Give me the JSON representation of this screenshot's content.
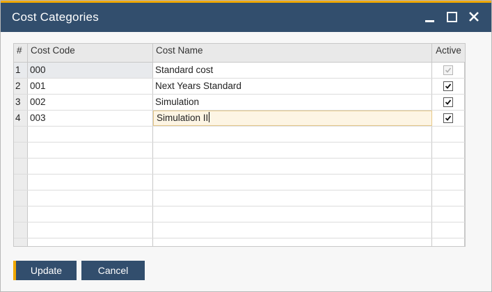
{
  "window": {
    "title": "Cost Categories"
  },
  "grid": {
    "columns": {
      "num": "#",
      "code": "Cost Code",
      "name": "Cost Name",
      "active": "Active"
    },
    "rows": [
      {
        "num": "1",
        "code": "000",
        "name": "Standard cost",
        "active": true,
        "active_disabled": true
      },
      {
        "num": "2",
        "code": "001",
        "name": "Next Years Standard",
        "active": true,
        "active_disabled": false
      },
      {
        "num": "3",
        "code": "002",
        "name": "Simulation",
        "active": true,
        "active_disabled": false
      },
      {
        "num": "4",
        "code": "003",
        "name": "Simulation II",
        "active": true,
        "active_disabled": false,
        "editing": true
      }
    ]
  },
  "buttons": {
    "update": "Update",
    "cancel": "Cancel"
  },
  "colors": {
    "titlebar": "#324e6d",
    "accent": "#f0a800",
    "edit_cell": "#fdf5e4"
  },
  "icons": {
    "minimize": "minimize-icon",
    "maximize": "maximize-icon",
    "close": "close-icon",
    "check": "checkmark-icon"
  }
}
